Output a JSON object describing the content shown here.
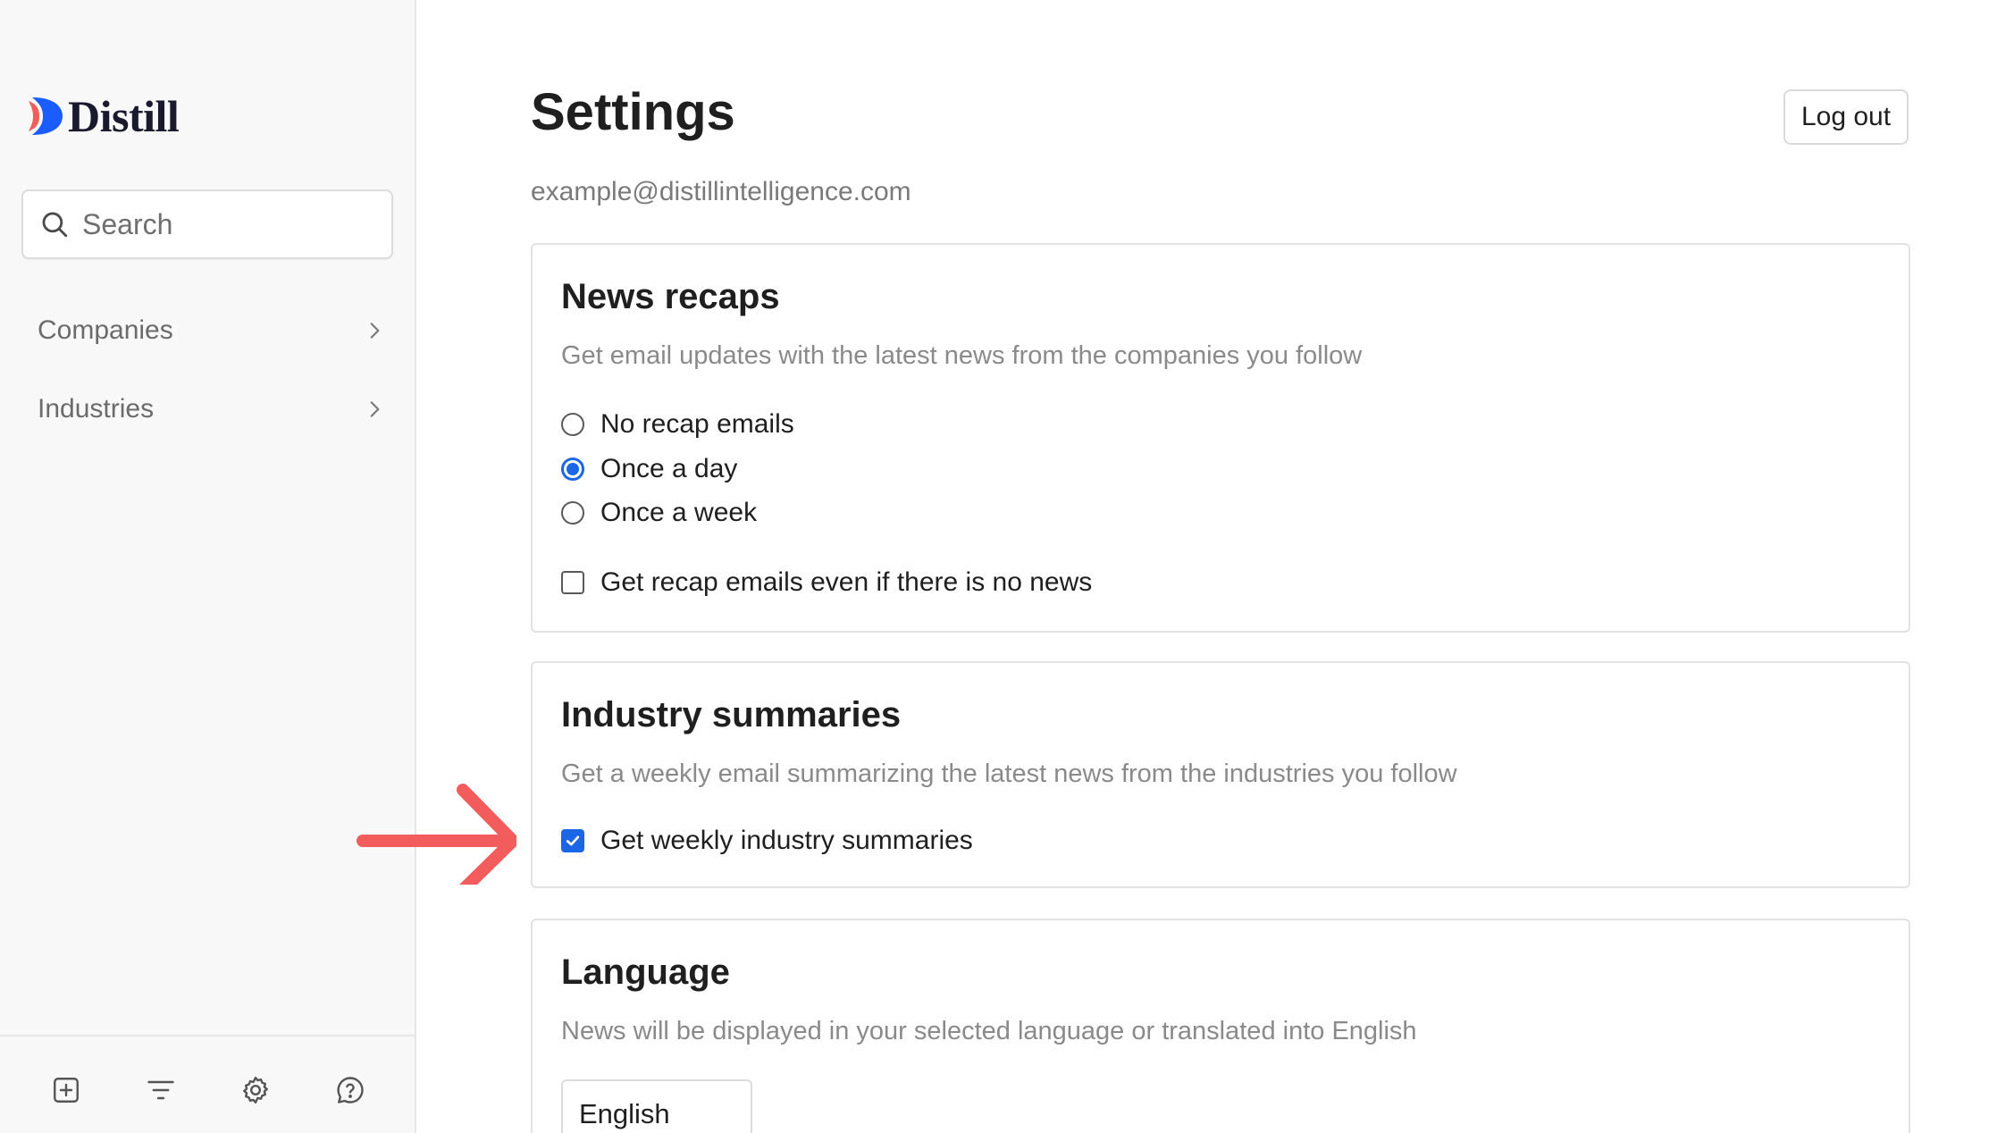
{
  "brand": {
    "name": "Distill",
    "logo_icon": "distill-logo-icon"
  },
  "search": {
    "placeholder": "Search",
    "icon": "search-icon"
  },
  "sidebar": {
    "items": [
      {
        "label": "Companies",
        "icon": "chevron-right-icon"
      },
      {
        "label": "Industries",
        "icon": "chevron-right-icon"
      }
    ],
    "footer_icons": [
      "add-square-icon",
      "filter-icon",
      "gear-icon",
      "help-chat-icon"
    ]
  },
  "header": {
    "title": "Settings",
    "logout_label": "Log out",
    "email": "example@distillintelligence.com"
  },
  "news_recaps": {
    "title": "News recaps",
    "description": "Get email updates with the latest news from the companies you follow",
    "options": [
      "No recap emails",
      "Once a day",
      "Once a week"
    ],
    "selected": "Once a day",
    "checkbox_label": "Get recap emails even if there is no news",
    "checkbox_checked": false
  },
  "industry_summaries": {
    "title": "Industry summaries",
    "description": "Get a weekly email summarizing the latest news from the industries you follow",
    "checkbox_label": "Get weekly industry summaries",
    "checkbox_checked": true
  },
  "language": {
    "title": "Language",
    "description": "News will be displayed in your selected language or translated into English",
    "selected": "English"
  },
  "colors": {
    "accent": "#1a66e6",
    "annotation_arrow": "#f25c5c",
    "logo_blue": "#1a5cff",
    "logo_coral": "#f25c5c"
  }
}
